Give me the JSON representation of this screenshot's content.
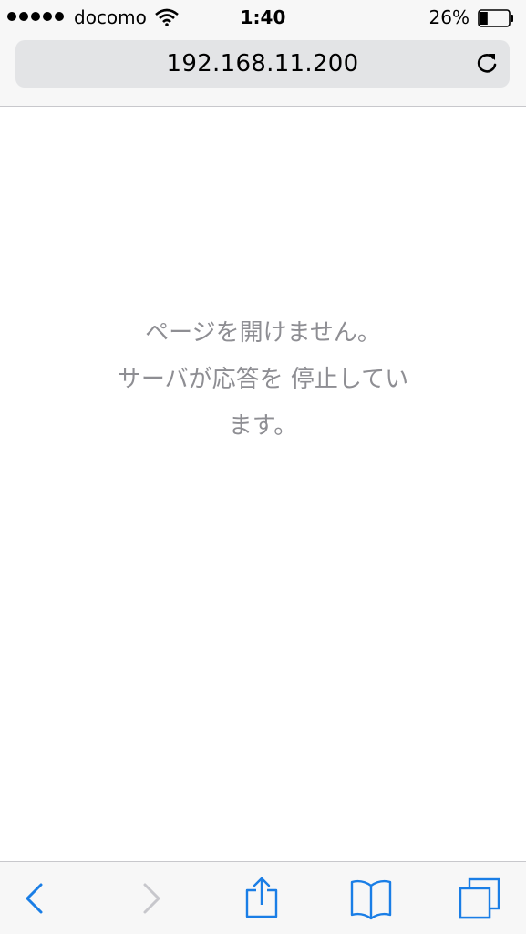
{
  "status_bar": {
    "signal_bars": 5,
    "carrier": "docomo",
    "time": "1:40",
    "battery_percent": "26%",
    "battery_level": 0.26
  },
  "address_bar": {
    "url": "192.168.11.200"
  },
  "page": {
    "error_line1": "ページを開けません。",
    "error_line2": "サーバが応答を 停止してい",
    "error_line3": "ます。"
  },
  "toolbar": {
    "items": [
      {
        "name": "back",
        "icon": "chevron-left-icon",
        "enabled": true
      },
      {
        "name": "forward",
        "icon": "chevron-right-icon",
        "enabled": false
      },
      {
        "name": "share",
        "icon": "share-icon",
        "enabled": true
      },
      {
        "name": "bookmarks",
        "icon": "book-icon",
        "enabled": true
      },
      {
        "name": "tabs",
        "icon": "tabs-icon",
        "enabled": true
      }
    ],
    "accent_color": "#1a7ee6",
    "disabled_color": "#c7c7cc"
  }
}
